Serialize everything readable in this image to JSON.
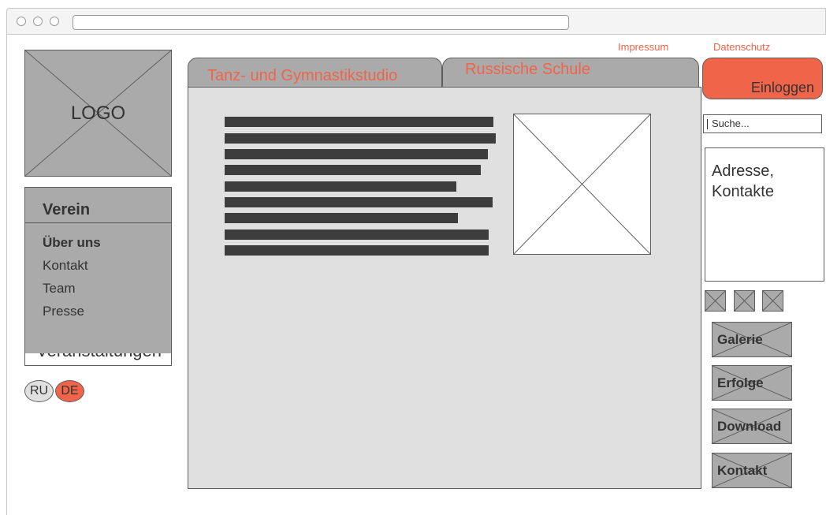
{
  "header": {
    "links": [
      "Impressum",
      "Datenschutz"
    ]
  },
  "logo": {
    "label": "LOGO"
  },
  "sidebar": {
    "title": "Verein",
    "items": [
      "Über uns",
      "Kontakt",
      "Team",
      "Presse"
    ],
    "hidden_item": "Veranstaltungen",
    "languages": [
      "RU",
      "DE"
    ],
    "active_language": "DE"
  },
  "tabs": [
    "Tanz- und Gymnastikstudio",
    "Russische Schule"
  ],
  "right": {
    "login_label": "Einloggen",
    "search_placeholder": "Suche...",
    "address_text": "Adresse, Kontakte",
    "social_icons": [
      "social-icon-1",
      "social-icon-2",
      "social-icon-3"
    ],
    "buttons": [
      "Galerie",
      "Erfolge",
      "Download",
      "Kontakt"
    ]
  },
  "colors": {
    "accent": "#f0644a",
    "panel_gray": "#aaaaaa",
    "content_gray": "#e0e0e0",
    "text_dark": "#333333"
  }
}
